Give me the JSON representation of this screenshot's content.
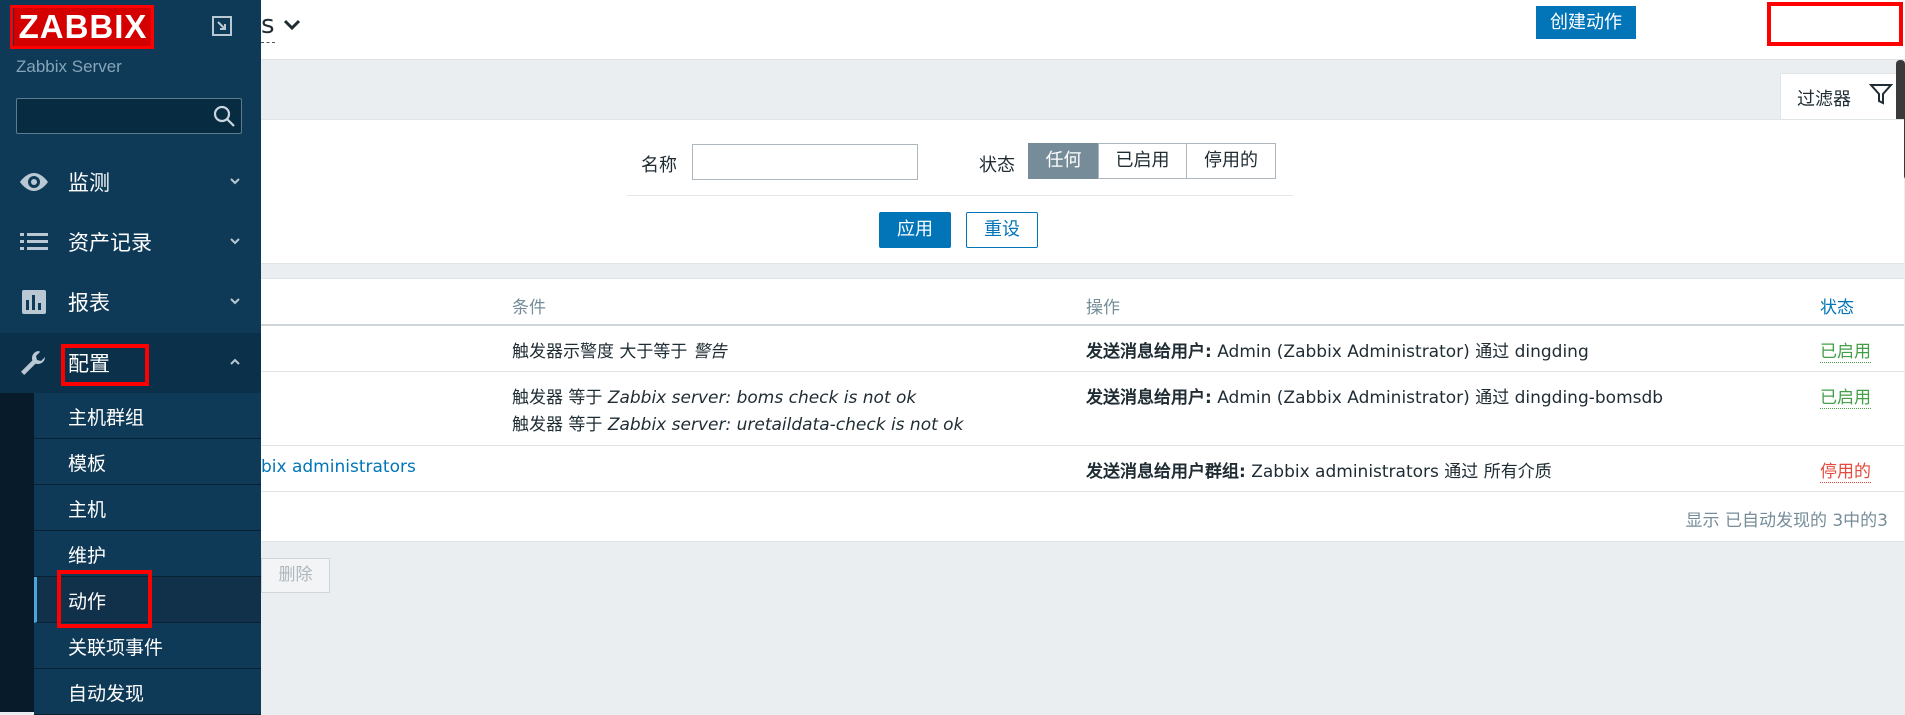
{
  "sidebar": {
    "logo": "ZABBIX",
    "server_name": "Zabbix Server",
    "search_placeholder": "",
    "menu": [
      {
        "label": "监测",
        "icon": "eye-icon"
      },
      {
        "label": "资产记录",
        "icon": "list-icon"
      },
      {
        "label": "报表",
        "icon": "bar-chart-icon"
      },
      {
        "label": "配置",
        "icon": "wrench-icon"
      }
    ],
    "submenu": [
      "主机群组",
      "模板",
      "主机",
      "维护",
      "动作",
      "关联项事件",
      "自动发现"
    ]
  },
  "header": {
    "title_fragment": "s",
    "create_button": "创建动作"
  },
  "filter": {
    "tab_label": "过滤器",
    "name_label": "名称",
    "name_value": "",
    "status_label": "状态",
    "status_options": [
      "任何",
      "已启用",
      "停用的"
    ],
    "status_selected": "任何",
    "apply": "应用",
    "reset": "重设"
  },
  "table": {
    "columns": {
      "conditions": "条件",
      "operations": "操作",
      "status": "状态"
    },
    "rows": [
      {
        "name": "",
        "conditions": [
          {
            "prefix": "触发器示警度 大于等于 ",
            "value": "警告"
          }
        ],
        "op_label": "发送消息给用户:",
        "op_text": " Admin (Zabbix Administrator) 通过 dingding",
        "status": "已启用"
      },
      {
        "name": "",
        "conditions": [
          {
            "prefix": "触发器 等于 ",
            "value": "Zabbix server: boms check is not ok"
          },
          {
            "prefix": "触发器 等于 ",
            "value": "Zabbix server: uretaildata-check is not ok"
          }
        ],
        "op_label": "发送消息给用户:",
        "op_text": " Admin (Zabbix Administrator) 通过 dingding-bomsdb",
        "status": "已启用"
      },
      {
        "name": "bix administrators",
        "conditions": [],
        "op_label": "发送消息给用户群组:",
        "op_text": " Zabbix administrators 通过 所有介质",
        "status": "停用的"
      }
    ],
    "footer": "显示 已自动发现的 3中的3",
    "delete_button": "删除"
  }
}
